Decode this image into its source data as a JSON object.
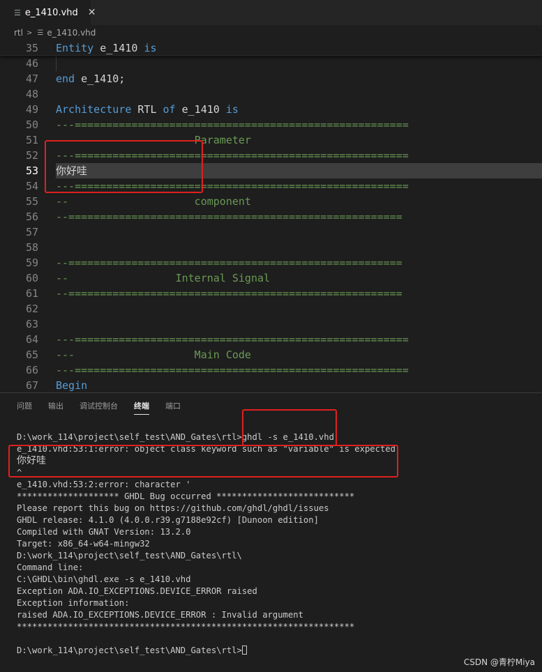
{
  "tab": {
    "title": "e_1410.vhd",
    "close": "✕",
    "icon": "file-lines-icon"
  },
  "breadcrumb": {
    "folder": "rtl",
    "separator": ">",
    "file": "e_1410.vhd"
  },
  "editor": {
    "active_line": "53",
    "lines": [
      {
        "no": "35",
        "t1": "Entity",
        "t2": " e_1410 ",
        "t3": "is"
      },
      {
        "no": "46",
        "t1": "",
        "t2": "",
        "t3": ""
      },
      {
        "no": "47",
        "t1": "end",
        "t2": " e_1410;",
        "t3": ""
      },
      {
        "no": "48",
        "t1": "",
        "t2": "",
        "t3": ""
      },
      {
        "no": "49",
        "t1": "Architecture",
        "t2": " RTL ",
        "t3": "of",
        "t4": " e_1410 ",
        "t5": "is"
      },
      {
        "no": "50",
        "comment": "---====================================================="
      },
      {
        "no": "51",
        "comment": "                      Parameter"
      },
      {
        "no": "52",
        "comment": "---====================================================="
      },
      {
        "no": "53",
        "text": "你好哇"
      },
      {
        "no": "54",
        "comment": "---====================================================="
      },
      {
        "no": "55",
        "comment": "--                    component"
      },
      {
        "no": "56",
        "comment": "--====================================================="
      },
      {
        "no": "57",
        "comment": ""
      },
      {
        "no": "58",
        "comment": ""
      },
      {
        "no": "59",
        "comment": "--====================================================="
      },
      {
        "no": "60",
        "comment": "--                 Internal Signal"
      },
      {
        "no": "61",
        "comment": "--====================================================="
      },
      {
        "no": "62",
        "comment": ""
      },
      {
        "no": "63",
        "comment": ""
      },
      {
        "no": "64",
        "comment": "---====================================================="
      },
      {
        "no": "65",
        "comment": "---                   Main Code"
      },
      {
        "no": "66",
        "comment": "---====================================================="
      },
      {
        "no": "67",
        "kw": "Begin"
      }
    ]
  },
  "panel": {
    "tabs": [
      "问题",
      "输出",
      "调试控制台",
      "终端",
      "端口"
    ],
    "active_tab": "终端",
    "terminal": [
      "",
      "D:\\work_114\\project\\self_test\\AND_Gates\\rtl>ghdl -s e_1410.vhd",
      "e_1410.vhd:53:1:error: object class keyword such as \"variable\" is expected",
      "你好哇",
      "^",
      "e_1410.vhd:53:2:error: character '",
      "******************** GHDL Bug occurred ***************************",
      "Please report this bug on https://github.com/ghdl/ghdl/issues",
      "GHDL release: 4.1.0 (4.0.0.r39.g7188e92cf) [Dunoon edition]",
      "Compiled with GNAT Version: 13.2.0",
      "Target: x86_64-w64-mingw32",
      "D:\\work_114\\project\\self_test\\AND_Gates\\rtl\\",
      "Command line:",
      "C:\\GHDL\\bin\\ghdl.exe -s e_1410.vhd",
      "Exception ADA.IO_EXCEPTIONS.DEVICE_ERROR raised",
      "Exception information:",
      "raised ADA.IO_EXCEPTIONS.DEVICE_ERROR : Invalid argument",
      "******************************************************************",
      "",
      "D:\\work_114\\project\\self_test\\AND_Gates\\rtl>"
    ]
  },
  "watermark": "CSDN @青柠Miya",
  "colors": {
    "keyword": "#569cd6",
    "comment": "#6a9955",
    "annotation": "#e0201f"
  }
}
